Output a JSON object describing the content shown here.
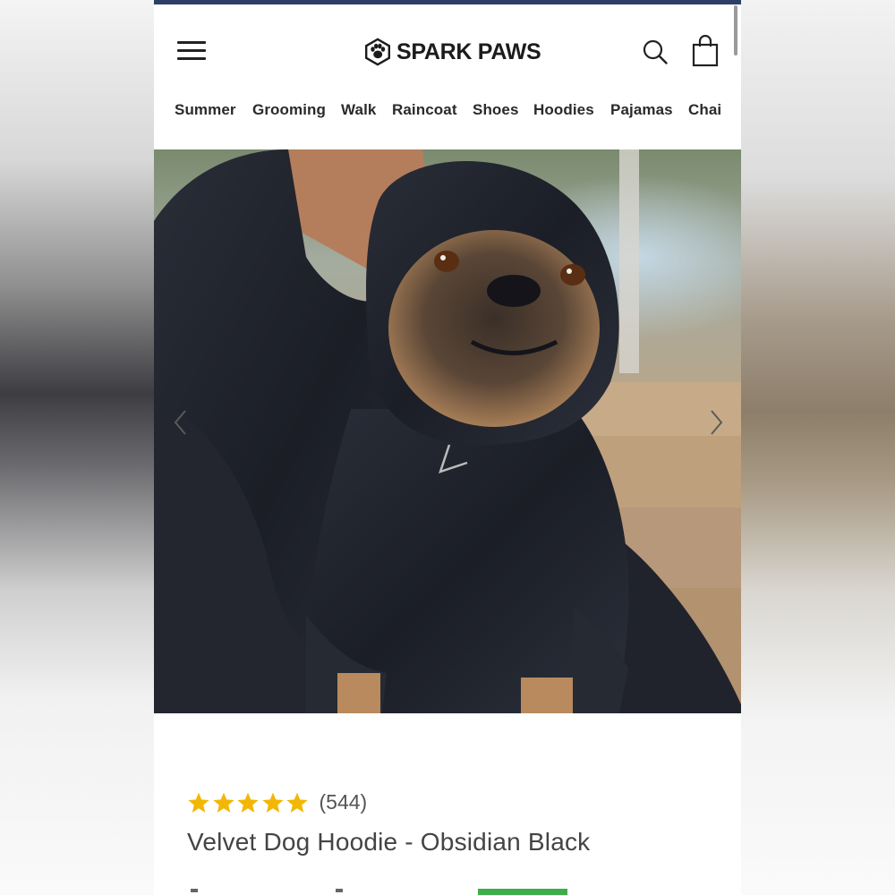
{
  "brand": {
    "name": "SPARK PAWS"
  },
  "header": {
    "menu_icon": "hamburger-menu-icon",
    "search_icon": "search-icon",
    "cart_icon": "shopping-bag-icon"
  },
  "nav": {
    "items": [
      {
        "label": "Summer"
      },
      {
        "label": "Grooming"
      },
      {
        "label": "Walk"
      },
      {
        "label": "Raincoat"
      },
      {
        "label": "Shoes"
      },
      {
        "label": "Hoodies"
      },
      {
        "label": "Pajamas"
      },
      {
        "label": "Chai"
      }
    ]
  },
  "gallery": {
    "prev_icon": "chevron-left-icon",
    "next_icon": "chevron-right-icon"
  },
  "product": {
    "rating_stars": 5,
    "review_count": "(544)",
    "title": "Velvet Dog Hoodie - Obsidian Black"
  },
  "colors": {
    "accent_bar": "#2e3f66",
    "star": "#f2b705",
    "badge": "#3dae49"
  }
}
